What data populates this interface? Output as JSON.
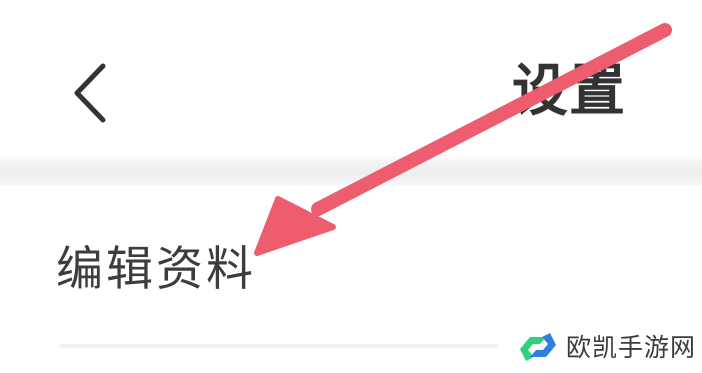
{
  "header": {
    "back_icon": "chevron-left-icon",
    "title": "设置"
  },
  "settings_list": {
    "items": [
      {
        "label": "编辑资料"
      }
    ]
  },
  "annotation": {
    "arrow_color": "#ee5d6f"
  },
  "watermark": {
    "text": "欧凯手游网",
    "logo_colors": [
      "#2fd17a",
      "#2f7fe3"
    ]
  },
  "colors": {
    "background": "#ffffff",
    "text": "#333333",
    "divider": "#eeeeee"
  }
}
